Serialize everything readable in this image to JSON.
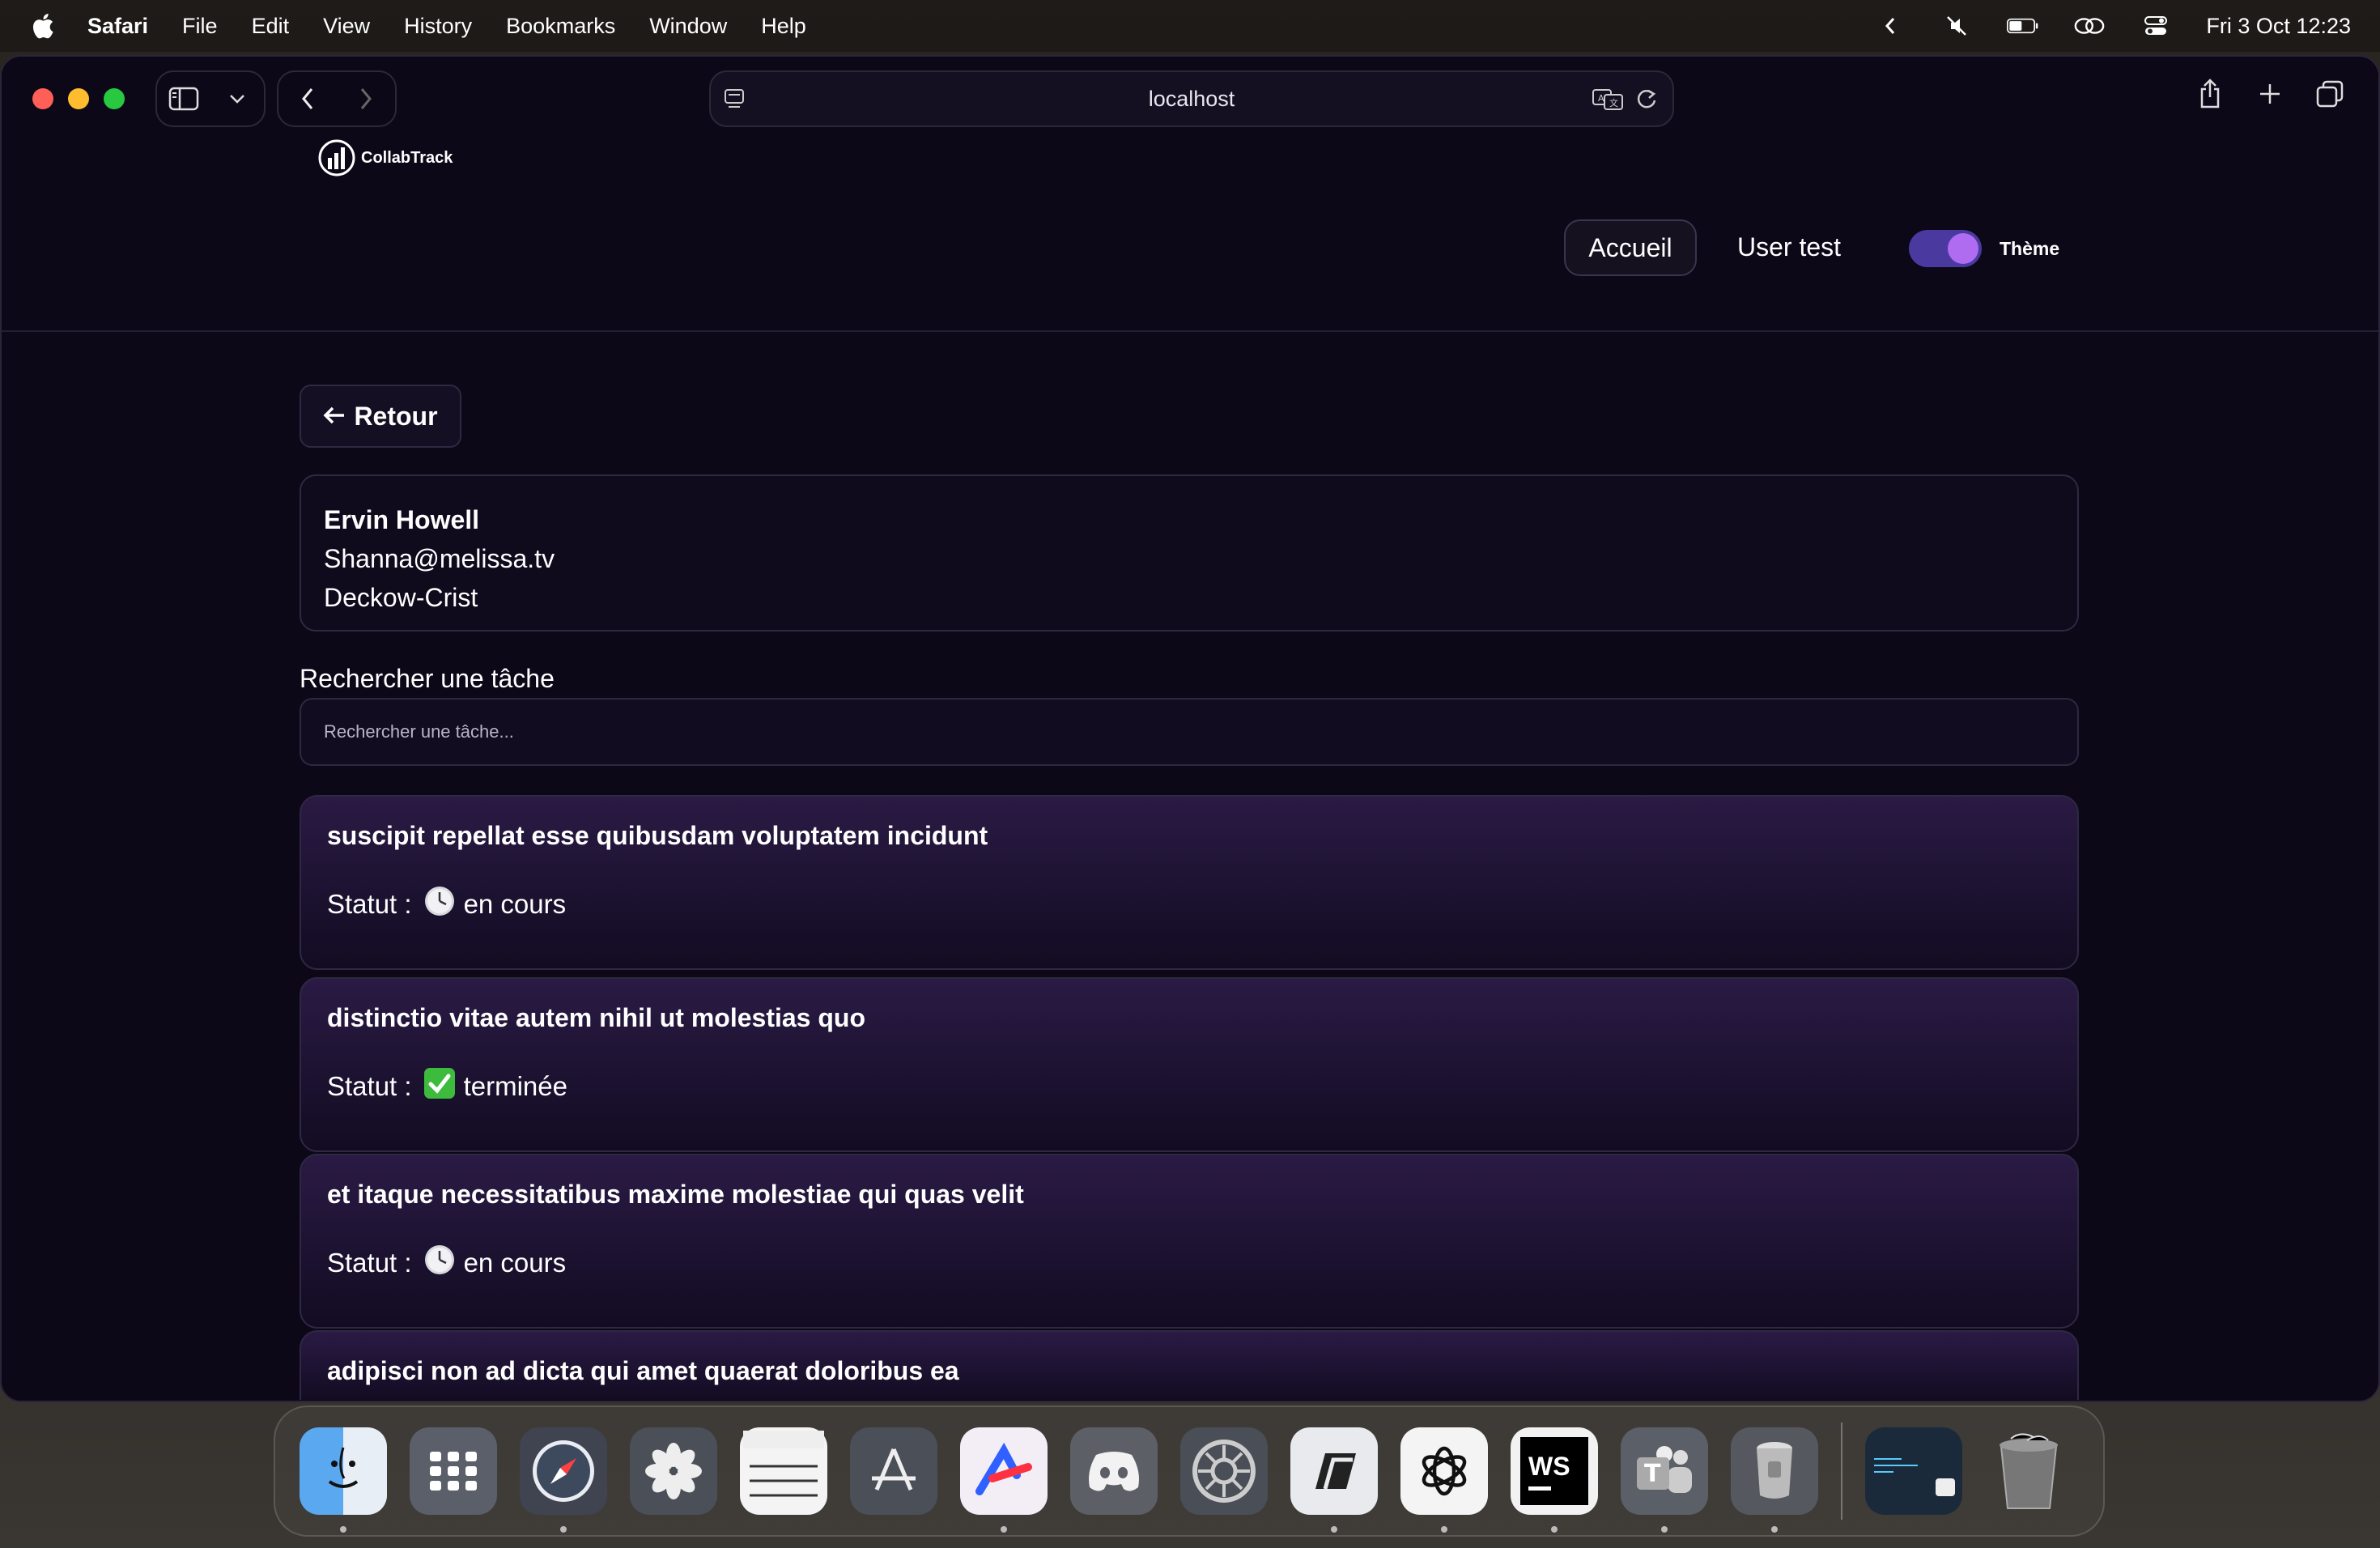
{
  "menubar": {
    "app_name": "Safari",
    "items": [
      "File",
      "Edit",
      "View",
      "History",
      "Bookmarks",
      "Window",
      "Help"
    ],
    "clock": "Fri 3 Oct  12:23"
  },
  "browser": {
    "url": "localhost"
  },
  "site": {
    "logo_text": "CollabTrack",
    "nav_home": "Accueil",
    "nav_user": "User test",
    "theme_label": "Thème"
  },
  "back_button": "Retour",
  "user": {
    "name": "Ervin Howell",
    "email": "Shanna@melissa.tv",
    "company": "Deckow-Crist"
  },
  "search": {
    "label": "Rechercher une tâche",
    "placeholder": "Rechercher une tâche...",
    "value": ""
  },
  "status_prefix": "Statut :",
  "tasks": [
    {
      "title": "suscipit repellat esse quibusdam voluptatem incidunt",
      "status_icon": "clock-icon",
      "status": "en cours"
    },
    {
      "title": "distinctio vitae autem nihil ut molestias quo",
      "status_icon": "check-icon",
      "status": "terminée"
    },
    {
      "title": "et itaque necessitatibus maxime molestiae qui quas velit",
      "status_icon": "clock-icon",
      "status": "en cours"
    },
    {
      "title": "adipisci non ad dicta qui amet quaerat doloribus ea",
      "status_icon": "clock-icon",
      "status": ""
    }
  ],
  "dock": {
    "apps": [
      "finder",
      "launchpad",
      "safari",
      "photos",
      "notes",
      "app-store",
      "raycast",
      "discord",
      "system-settings",
      "parallels",
      "chatgpt",
      "webstorm",
      "teams",
      "flashlight"
    ],
    "running": [
      "finder",
      "safari",
      "raycast",
      "parallels",
      "chatgpt",
      "webstorm",
      "teams",
      "flashlight"
    ]
  },
  "colors": {
    "page_bg": "#0c0818",
    "accent": "#b06cf0",
    "toggle_track": "#4a3aa0",
    "task_gradient_top": "#2a1a44"
  }
}
